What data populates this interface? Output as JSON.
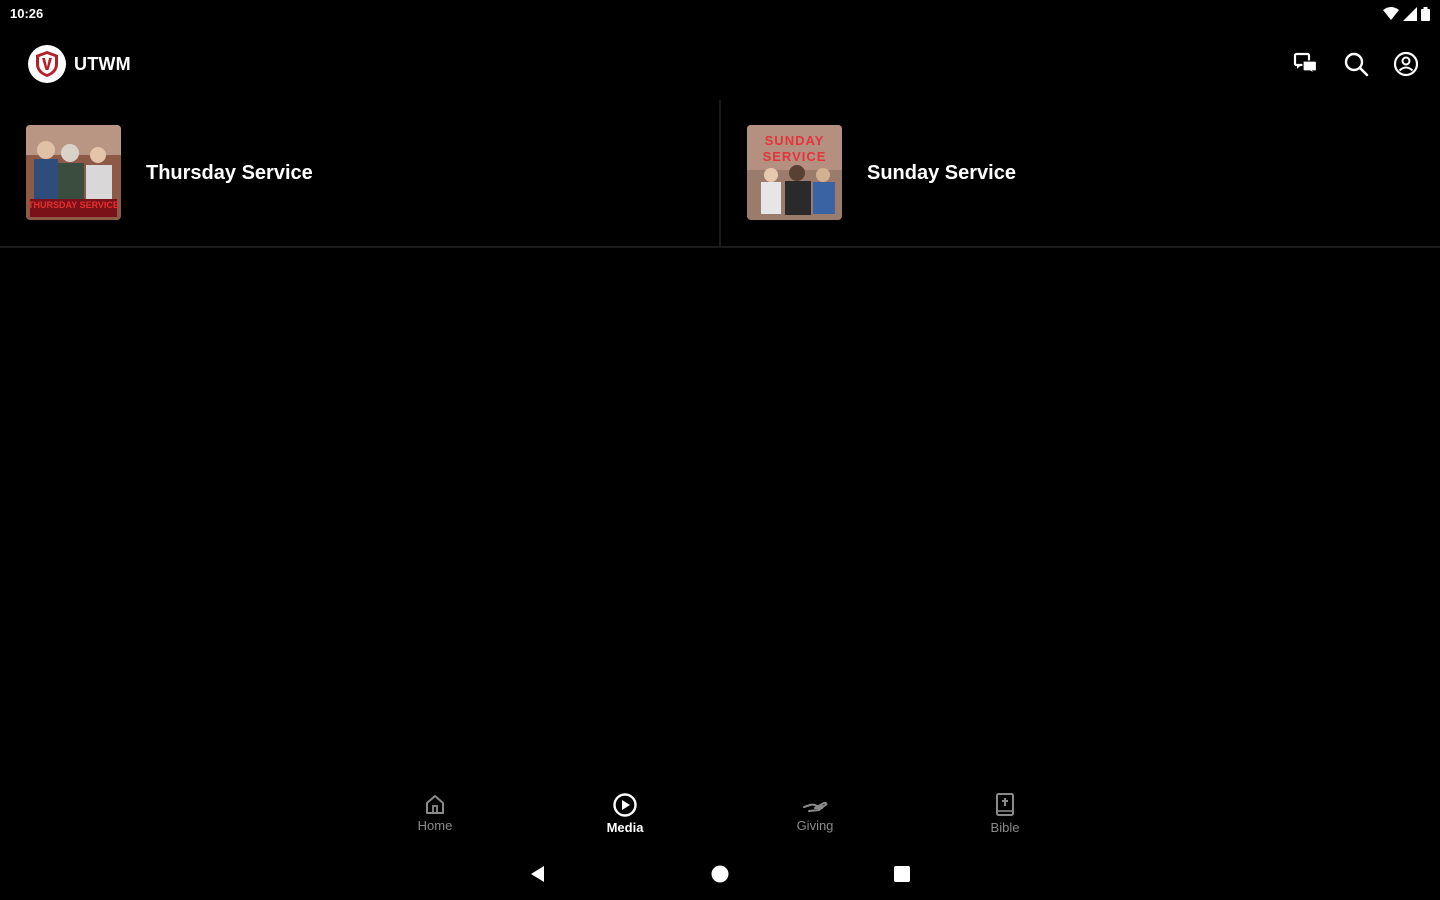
{
  "status_bar": {
    "time": "10:26"
  },
  "app_bar": {
    "title": "UTWM",
    "logo_letter": "U",
    "actions": [
      "chat-icon",
      "search-icon",
      "account-icon"
    ]
  },
  "media": {
    "items": [
      {
        "title": "Thursday Service",
        "thumbnail_text": "THURSDAY SERVICE"
      },
      {
        "title": "Sunday Service",
        "thumbnail_text": "SUNDAY SERVICE"
      }
    ]
  },
  "bottom_nav": {
    "items": [
      {
        "label": "Home",
        "icon": "home-icon",
        "active": false
      },
      {
        "label": "Media",
        "icon": "play-circle-icon",
        "active": true
      },
      {
        "label": "Giving",
        "icon": "giving-icon",
        "active": false
      },
      {
        "label": "Bible",
        "icon": "bible-icon",
        "active": false
      }
    ]
  },
  "colors": {
    "background": "#000000",
    "text_primary": "#ffffff",
    "text_inactive": "#8a8a8a",
    "divider": "#1a1a1a",
    "logo_red": "#b3202a"
  }
}
